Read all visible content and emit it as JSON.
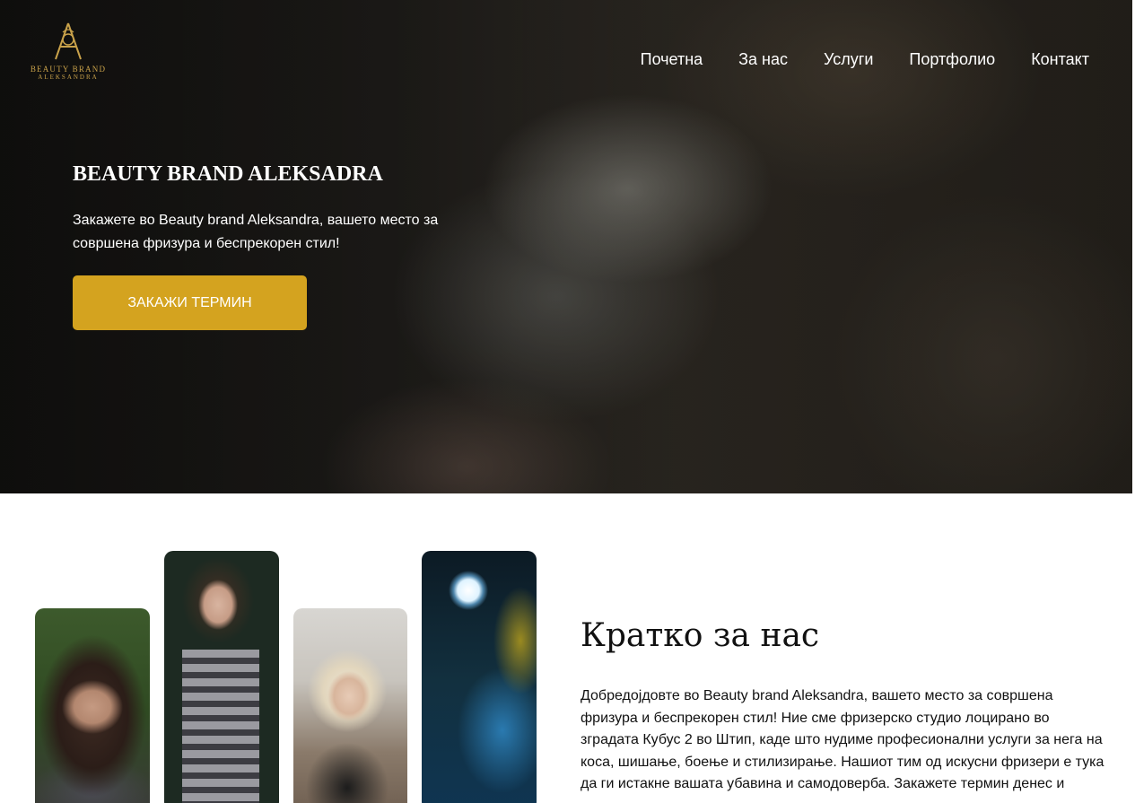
{
  "logo": {
    "line1": "BEAUTY BRAND",
    "line2": "ALEKSANDRA"
  },
  "nav": [
    "Почетна",
    "За нас",
    "Услуги",
    "Портфолио",
    "Контакт"
  ],
  "hero": {
    "title": "BEAUTY BRAND ALEKSADRA",
    "text": "Закажете во Beauty brand Aleksandra, вашето место за совршена фризура и беспрекорен стил!",
    "cta": "ЗАКАЖИ ТЕРМИН"
  },
  "about": {
    "title": "Кратко за нас",
    "text": "Добредојдовте во Beauty brand Aleksandra, вашето место за совршена фризура и беспрекорен стил! Ние сме фризерско студио лоцирано во зградата Кубус 2 во Штип, каде што нудиме професионални услуги за нега на коса, шишање, боење и стилизирање. Нашиот тим од искусни фризери е тука да ги истакне вашата убавина и самодоверба. Закажете термин денес и"
  },
  "colors": {
    "accent": "#d4a31f",
    "logo_gold": "#c9a24a"
  },
  "icons": [
    "logo-emblem-icon"
  ]
}
